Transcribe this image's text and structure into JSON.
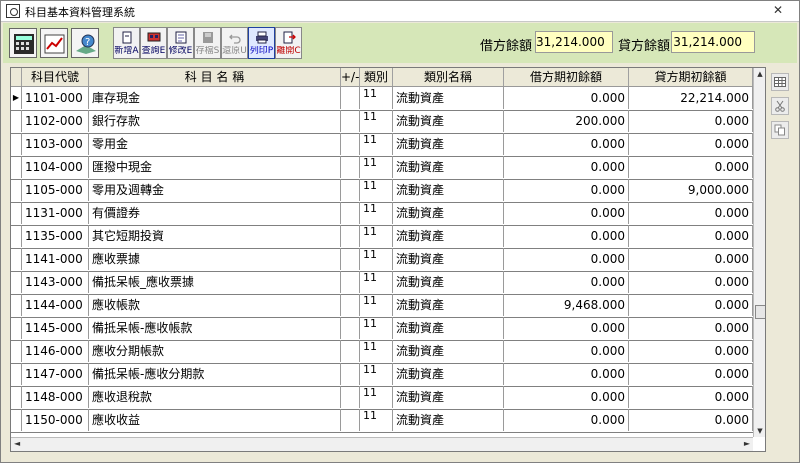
{
  "window": {
    "title": "科目基本資料管理系統",
    "close_glyph": "✕"
  },
  "toolbar": {
    "buttons": [
      {
        "label": "新增A",
        "icon": "new-document-icon",
        "state": "normal"
      },
      {
        "label": "查詢E",
        "icon": "search-icon",
        "state": "normal"
      },
      {
        "label": "修改E",
        "icon": "edit-icon",
        "state": "normal"
      },
      {
        "label": "存檔S",
        "icon": "save-icon",
        "state": "disabled"
      },
      {
        "label": "還原U",
        "icon": "undo-icon",
        "state": "disabled"
      },
      {
        "label": "列印P",
        "icon": "print-icon",
        "state": "active"
      },
      {
        "label": "離開C",
        "icon": "exit-icon",
        "state": "normal"
      }
    ],
    "debit_label": "借方餘額",
    "debit_value": "31,214.000",
    "credit_label": "貸方餘額",
    "credit_value": "31,214.000"
  },
  "grid": {
    "headers": [
      "",
      "科目代號",
      "科  目  名  稱",
      "+/-",
      "類別",
      "類別名稱",
      "借方期初餘額",
      "貸方期初餘額"
    ],
    "current_row_indicator": "▶",
    "rows": [
      {
        "code": "1101-000",
        "name": "庫存現金",
        "sign": "",
        "type": "11",
        "type_name": "流動資產",
        "debit": "0.000",
        "credit": "22,214.000"
      },
      {
        "code": "1102-000",
        "name": "銀行存款",
        "sign": "",
        "type": "11",
        "type_name": "流動資產",
        "debit": "200.000",
        "credit": "0.000"
      },
      {
        "code": "1103-000",
        "name": "零用金",
        "sign": "",
        "type": "11",
        "type_name": "流動資產",
        "debit": "0.000",
        "credit": "0.000"
      },
      {
        "code": "1104-000",
        "name": "匯撥中現金",
        "sign": "",
        "type": "11",
        "type_name": "流動資產",
        "debit": "0.000",
        "credit": "0.000"
      },
      {
        "code": "1105-000",
        "name": "零用及週轉金",
        "sign": "",
        "type": "11",
        "type_name": "流動資產",
        "debit": "0.000",
        "credit": "9,000.000"
      },
      {
        "code": "1131-000",
        "name": "有價證券",
        "sign": "",
        "type": "11",
        "type_name": "流動資產",
        "debit": "0.000",
        "credit": "0.000"
      },
      {
        "code": "1135-000",
        "name": "其它短期投資",
        "sign": "",
        "type": "11",
        "type_name": "流動資產",
        "debit": "0.000",
        "credit": "0.000"
      },
      {
        "code": "1141-000",
        "name": "應收票據",
        "sign": "",
        "type": "11",
        "type_name": "流動資產",
        "debit": "0.000",
        "credit": "0.000"
      },
      {
        "code": "1143-000",
        "name": "備抵呆帳_應收票據",
        "sign": "",
        "type": "11",
        "type_name": "流動資產",
        "debit": "0.000",
        "credit": "0.000"
      },
      {
        "code": "1144-000",
        "name": "應收帳款",
        "sign": "",
        "type": "11",
        "type_name": "流動資產",
        "debit": "9,468.000",
        "credit": "0.000"
      },
      {
        "code": "1145-000",
        "name": "備抵呆帳-應收帳款",
        "sign": "",
        "type": "11",
        "type_name": "流動資產",
        "debit": "0.000",
        "credit": "0.000"
      },
      {
        "code": "1146-000",
        "name": "應收分期帳款",
        "sign": "",
        "type": "11",
        "type_name": "流動資產",
        "debit": "0.000",
        "credit": "0.000"
      },
      {
        "code": "1147-000",
        "name": "備抵呆帳-應收分期款",
        "sign": "",
        "type": "11",
        "type_name": "流動資產",
        "debit": "0.000",
        "credit": "0.000"
      },
      {
        "code": "1148-000",
        "name": "應收退稅款",
        "sign": "",
        "type": "11",
        "type_name": "流動資產",
        "debit": "0.000",
        "credit": "0.000"
      },
      {
        "code": "1150-000",
        "name": "應收收益",
        "sign": "",
        "type": "11",
        "type_name": "流動資產",
        "debit": "0.000",
        "credit": "0.000"
      }
    ]
  },
  "scroll": {
    "up": "▲",
    "down": "▼",
    "left": "◄",
    "right": "►"
  },
  "side_tools": [
    "grid-view-icon",
    "cut-icon",
    "copy-icon"
  ]
}
